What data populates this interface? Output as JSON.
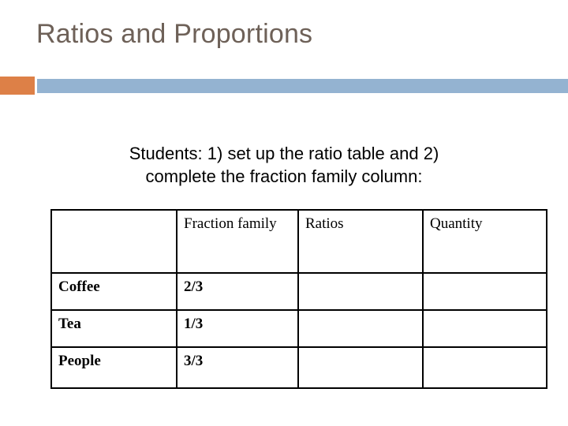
{
  "slide": {
    "title": "Ratios and Proportions",
    "title_color": "#6E6158",
    "accent_orange": "#DD8047",
    "accent_blue": "#94B3D1",
    "instruction_line_1": "Students: 1) set up the ratio table and 2)",
    "instruction_line_2": "complete the fraction family column:"
  },
  "table": {
    "headers": {
      "corner": "",
      "fraction_family": "Fraction family",
      "ratios": "Ratios",
      "quantity": "Quantity"
    },
    "rows": [
      {
        "label": "Coffee",
        "fraction_family": "2/3",
        "ratios": "",
        "quantity": ""
      },
      {
        "label": "Tea",
        "fraction_family": "1/3",
        "ratios": "",
        "quantity": ""
      },
      {
        "label": "People",
        "fraction_family": "3/3",
        "ratios": "",
        "quantity": ""
      }
    ]
  }
}
